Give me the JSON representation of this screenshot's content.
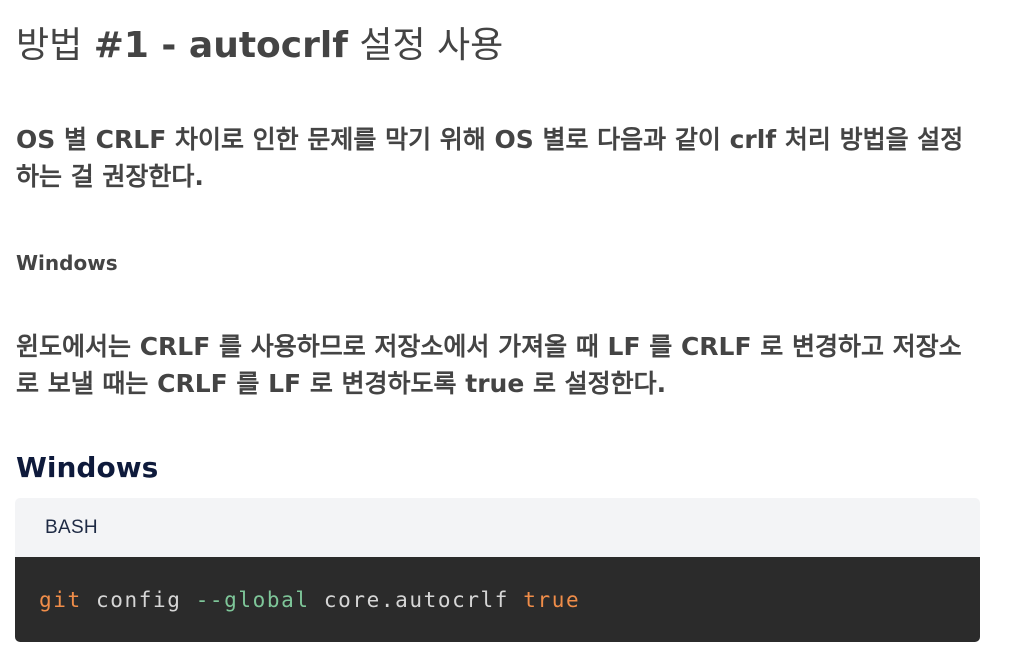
{
  "title": {
    "prefix": "방법 ",
    "bold": "#1 - autocrlf",
    "suffix": " 설정 사용"
  },
  "lead": "OS 별 CRLF 차이로 인한 문제를 막기 위해 OS 별로 다음과 같이 crlf 처리 방법을 설정하는 걸 권장한다.",
  "small_heading": "Windows",
  "paragraph": "윈도에서는 CRLF 를 사용하므로 저장소에서 가져올 때 LF 를 CRLF 로 변경하고 저장소로 보낼 때는 CRLF 를 LF 로 변경하도록 true 로 설정한다.",
  "section_heading": "Windows",
  "code": {
    "language": "BASH",
    "tokens": {
      "cmd": "git",
      "sp1": " config ",
      "flag": "--global",
      "sp2": " core.autocrlf ",
      "value": "true"
    }
  },
  "colors": {
    "text": "#444444",
    "heading": "#0e1a3b",
    "code_header_bg": "#f3f4f6",
    "code_bg": "#2b2b2b",
    "token_orange": "#f08d49",
    "token_green": "#7ec699",
    "token_plain": "#d6d6d6"
  }
}
